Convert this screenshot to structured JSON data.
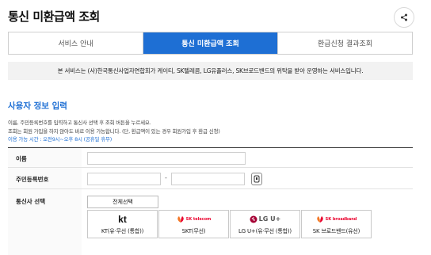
{
  "page": {
    "title": "통신 미환급액 조회"
  },
  "tabs": [
    {
      "label": "서비스 안내",
      "active": false
    },
    {
      "label": "통신 미환급액 조회",
      "active": true
    },
    {
      "label": "환급신청 결과조회",
      "active": false
    }
  ],
  "notice": "본 서비스는 (사)한국통신사업자연합회가 케이티, SK텔레콤, LG유플러스, SK브로드밴드의 위탁을 받아 운영하는 서비스입니다.",
  "section": {
    "title": "사용자 정보 입력",
    "desc1": "이름, 주민등록번호를 입력하고 통신사 선택 후 조회 버튼을 누르세요.",
    "desc2": "조회는 회원 가입을 하지 않아도 바로 이용 가능합니다. (단, 환급액이 있는 경우 회원가입 후 환급 신청)",
    "desc3": "이용 가능 시간 : 오전9시~오후 8시 (공휴일 휴무)"
  },
  "form": {
    "name_label": "이름",
    "name_value": "",
    "rrn_label": "주민등록번호",
    "rrn_front_value": "",
    "rrn_back_value": "",
    "rrn_separator": "-",
    "carrier_label": "통신사 선택",
    "select_all_label": "전체선택"
  },
  "carriers": [
    {
      "logo_text": "kt",
      "label": "KT(유·무선 (통합))",
      "color": "#e60012"
    },
    {
      "logo_text": "SK telecom",
      "label": "SKT(무선)",
      "color": "#ea002c"
    },
    {
      "logo_text": "LG U+",
      "label": "LG U+(유·무선 (통합))",
      "color": "#a50034"
    },
    {
      "logo_text": "SK broadband",
      "label": "SK 브로드밴드(유선)",
      "color": "#ea002c"
    }
  ],
  "colors": {
    "accent": "#1e6fd4"
  }
}
